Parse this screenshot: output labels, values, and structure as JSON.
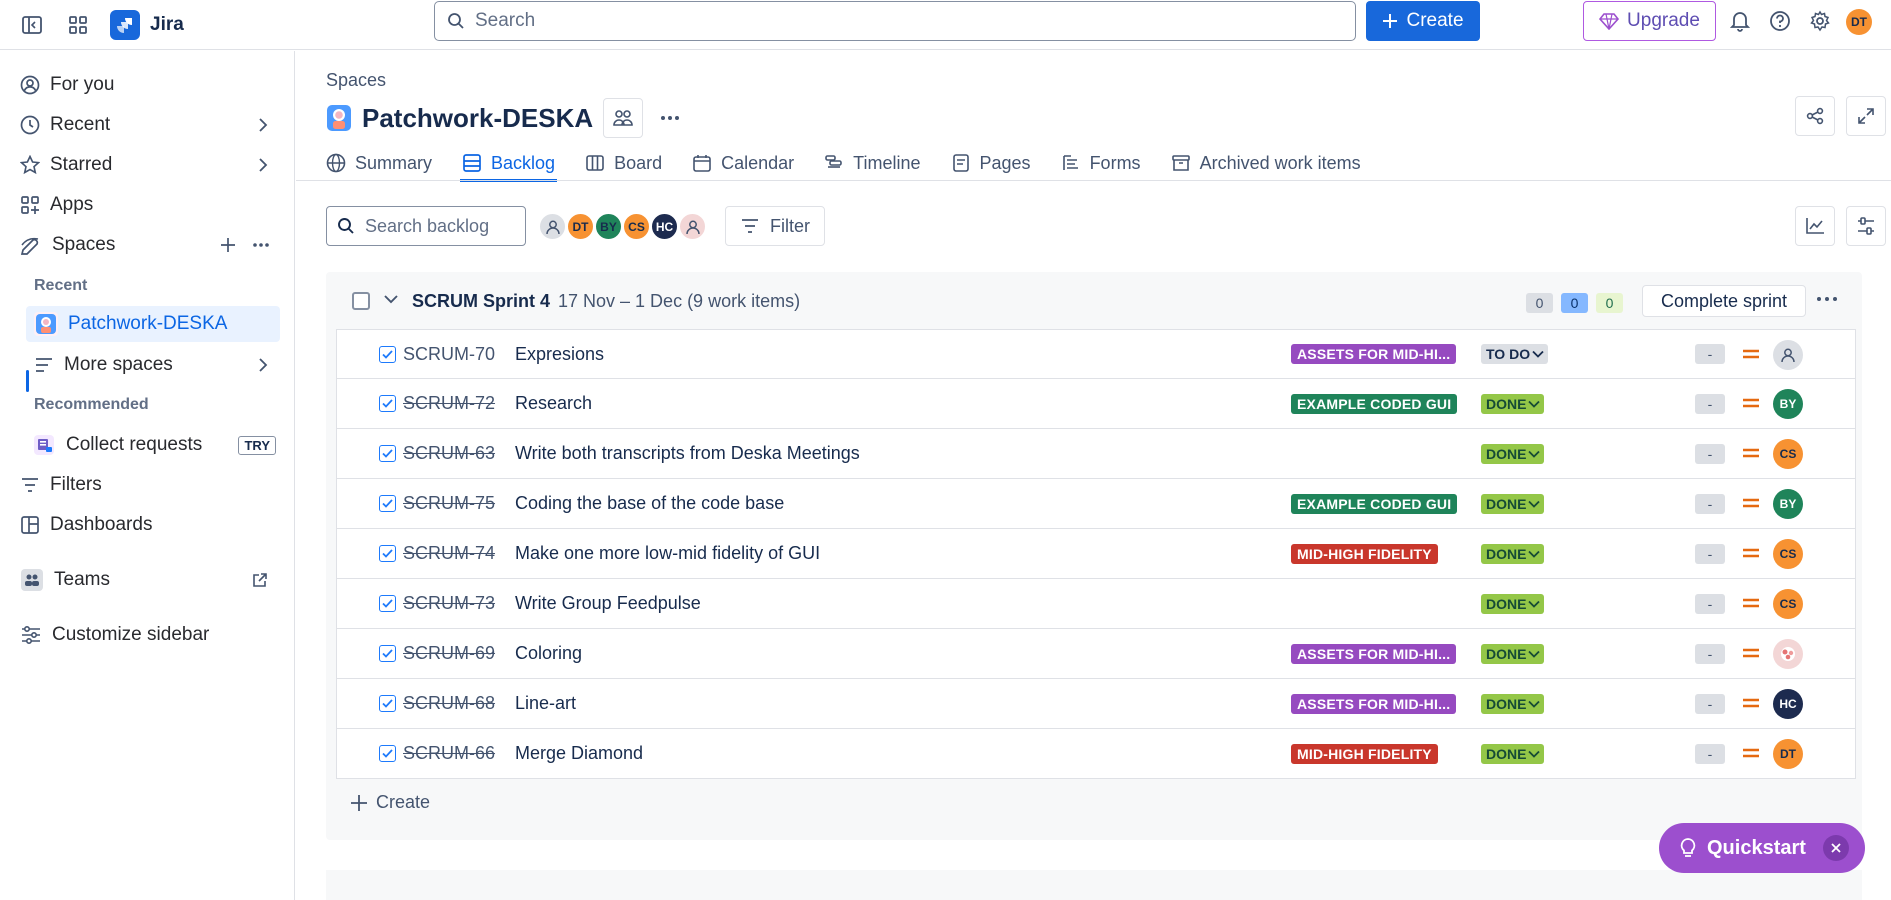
{
  "topbar": {
    "app_name": "Jira",
    "search_placeholder": "Search",
    "create_label": "Create",
    "upgrade_label": "Upgrade",
    "user_initials": "DT"
  },
  "sidebar": {
    "items": [
      {
        "label": "For you"
      },
      {
        "label": "Recent"
      },
      {
        "label": "Starred"
      },
      {
        "label": "Apps"
      },
      {
        "label": "Spaces"
      }
    ],
    "recent_heading": "Recent",
    "project_name": "Patchwork-DESKA",
    "more_spaces": "More spaces",
    "recommended_heading": "Recommended",
    "collect_requests": "Collect requests",
    "try_badge": "TRY",
    "filters": "Filters",
    "dashboards": "Dashboards",
    "teams": "Teams",
    "customize": "Customize sidebar"
  },
  "header": {
    "breadcrumb": "Spaces",
    "title": "Patchwork-DESKA",
    "tabs": [
      {
        "label": "Summary"
      },
      {
        "label": "Backlog"
      },
      {
        "label": "Board"
      },
      {
        "label": "Calendar"
      },
      {
        "label": "Timeline"
      },
      {
        "label": "Pages"
      },
      {
        "label": "Forms"
      },
      {
        "label": "Archived work items"
      }
    ]
  },
  "toolbar": {
    "search_placeholder": "Search backlog",
    "filter_label": "Filter",
    "avatars": [
      {
        "initials": "",
        "color": "#dcdfe4"
      },
      {
        "initials": "DT",
        "color": "#f79232"
      },
      {
        "initials": "BY",
        "color": "#1f845a"
      },
      {
        "initials": "CS",
        "color": "#f79232"
      },
      {
        "initials": "HC",
        "color": "#1d2b4f"
      },
      {
        "initials": "",
        "color": "#f3d6d6"
      }
    ]
  },
  "sprint": {
    "name": "SCRUM Sprint 4",
    "dates": "17 Nov – 1 Dec (9 work items)",
    "counts": [
      "0",
      "0",
      "0"
    ],
    "complete_label": "Complete sprint",
    "create_label": "Create",
    "items": [
      {
        "key": "SCRUM-70",
        "summary": "Expresions",
        "epic": "ASSETS FOR MID-HI...",
        "epic_color": "#964ac0",
        "status": "TO DO",
        "status_bg": "#dcdfe4",
        "status_fg": "#172b4d",
        "done": false,
        "estimate": "-",
        "assignee": "",
        "assignee_color": "#dcdfe4"
      },
      {
        "key": "SCRUM-72",
        "summary": "Research",
        "epic": "EXAMPLE CODED GUI",
        "epic_color": "#1f845a",
        "status": "DONE",
        "status_bg": "#94c748",
        "status_fg": "#164b35",
        "done": true,
        "estimate": "-",
        "assignee": "BY",
        "assignee_color": "#1f845a"
      },
      {
        "key": "SCRUM-63",
        "summary": "Write both transcripts from Deska Meetings",
        "epic": "",
        "epic_color": "",
        "status": "DONE",
        "status_bg": "#94c748",
        "status_fg": "#164b35",
        "done": true,
        "estimate": "-",
        "assignee": "CS",
        "assignee_color": "#f79232"
      },
      {
        "key": "SCRUM-75",
        "summary": "Coding the base of the code base",
        "epic": "EXAMPLE CODED GUI",
        "epic_color": "#1f845a",
        "status": "DONE",
        "status_bg": "#94c748",
        "status_fg": "#164b35",
        "done": true,
        "estimate": "-",
        "assignee": "BY",
        "assignee_color": "#1f845a"
      },
      {
        "key": "SCRUM-74",
        "summary": "Make one more low-mid fidelity of GUI",
        "epic": "MID-HIGH FIDELITY",
        "epic_color": "#c9372c",
        "status": "DONE",
        "status_bg": "#94c748",
        "status_fg": "#164b35",
        "done": true,
        "estimate": "-",
        "assignee": "CS",
        "assignee_color": "#f79232"
      },
      {
        "key": "SCRUM-73",
        "summary": "Write Group Feedpulse",
        "epic": "",
        "epic_color": "",
        "status": "DONE",
        "status_bg": "#94c748",
        "status_fg": "#164b35",
        "done": true,
        "estimate": "-",
        "assignee": "CS",
        "assignee_color": "#f79232"
      },
      {
        "key": "SCRUM-69",
        "summary": "Coloring",
        "epic": "ASSETS FOR MID-HI...",
        "epic_color": "#964ac0",
        "status": "DONE",
        "status_bg": "#94c748",
        "status_fg": "#164b35",
        "done": true,
        "estimate": "-",
        "assignee": "",
        "assignee_color": "#f3d6d6"
      },
      {
        "key": "SCRUM-68",
        "summary": "Line-art",
        "epic": "ASSETS FOR MID-HI...",
        "epic_color": "#964ac0",
        "status": "DONE",
        "status_bg": "#94c748",
        "status_fg": "#164b35",
        "done": true,
        "estimate": "-",
        "assignee": "HC",
        "assignee_color": "#1d2b4f"
      },
      {
        "key": "SCRUM-66",
        "summary": "Merge Diamond",
        "epic": "MID-HIGH FIDELITY",
        "epic_color": "#c9372c",
        "status": "DONE",
        "status_bg": "#94c748",
        "status_fg": "#164b35",
        "done": true,
        "estimate": "-",
        "assignee": "DT",
        "assignee_color": "#f79232"
      }
    ]
  },
  "quickstart_label": "Quickstart"
}
